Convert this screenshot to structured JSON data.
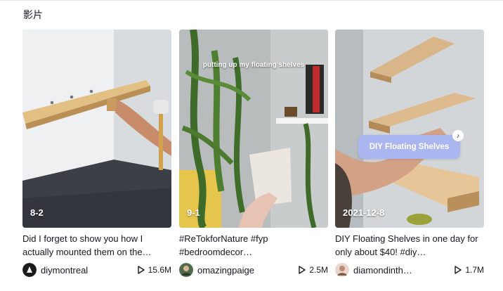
{
  "section": {
    "title": "影片"
  },
  "videos": [
    {
      "date": "8-2",
      "description": "Did I forget to show you how I actually mounted them on the…",
      "author": "diymontreal",
      "plays": "15.6M",
      "overlay_text": ""
    },
    {
      "date": "9-1",
      "description": "#ReTokforNature #fyp #bedroomdecor…",
      "author": "omazingpaige",
      "plays": "2.5M",
      "overlay_text": "putting up my floating shelves"
    },
    {
      "date": "2021-12-8",
      "description": "DIY Floating Shelves in one day for only about $40! #diy…",
      "author": "diamondinth…",
      "plays": "1.7M",
      "overlay_text": "DIY Floating Shelves"
    }
  ],
  "icons": {
    "play": "play-icon",
    "tiktok": "tiktok-icon"
  },
  "colors": {
    "text": "#161823",
    "sticker": "#a9b6ef"
  }
}
